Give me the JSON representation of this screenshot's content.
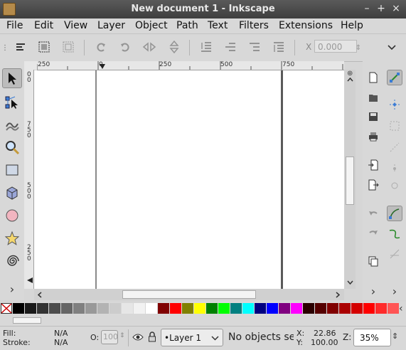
{
  "window": {
    "title": "New document 1 - Inkscape",
    "controls": [
      "–",
      "+",
      "×"
    ]
  },
  "menu": [
    "File",
    "Edit",
    "View",
    "Layer",
    "Object",
    "Path",
    "Text",
    "Filters",
    "Extensions",
    "Help"
  ],
  "controls": {
    "x_label": "X",
    "x_value": "0.000"
  },
  "hruler_labels": [
    "250",
    "0",
    "250",
    "500",
    "750"
  ],
  "vruler_labels": [
    "0",
    "0",
    "7",
    "5",
    "0",
    "5",
    "0",
    "0",
    "2",
    "5",
    "0"
  ],
  "palette_colors": [
    "#000000",
    "#1a1a1a",
    "#333333",
    "#4d4d4d",
    "#666666",
    "#808080",
    "#999999",
    "#b3b3b3",
    "#cccccc",
    "#e6e6e6",
    "#f2f2f2",
    "#ffffff",
    "#800000",
    "#ff0000",
    "#808000",
    "#ffff00",
    "#008000",
    "#00ff00",
    "#008080",
    "#00ffff",
    "#000080",
    "#0000ff",
    "#800080",
    "#ff00ff",
    "#2b0000",
    "#550000",
    "#800000",
    "#aa0000",
    "#d40000",
    "#ff0000",
    "#ff2a2a",
    "#ff5555"
  ],
  "status": {
    "fill_label": "Fill:",
    "fill_value": "N/A",
    "stroke_label": "Stroke:",
    "stroke_value": "N/A",
    "opacity_label": "O:",
    "opacity_value": "100",
    "layer": "•Layer 1",
    "message": "No objects se",
    "x_label": "X:",
    "x_value": "22.86",
    "y_label": "Y:",
    "y_value": "100.00",
    "zoom_label": "Z:",
    "zoom_value": "35%"
  },
  "colors": {
    "selected_tool_bg": "#bcbcbc",
    "canvas_bg": "#ffffff",
    "titlebar": "#3e3e3e"
  }
}
